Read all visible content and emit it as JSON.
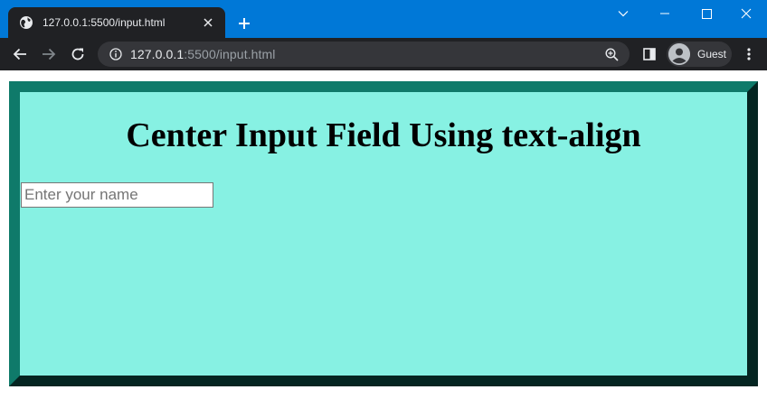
{
  "browser": {
    "tab": {
      "title": "127.0.0.1:5500/input.html"
    },
    "address": {
      "host": "127.0.0.1",
      "rest": ":5500/input.html"
    },
    "profile": {
      "label": "Guest"
    }
  },
  "page": {
    "heading": "Center Input Field Using text-align",
    "input": {
      "placeholder": "Enter your name",
      "value": ""
    }
  },
  "colors": {
    "titlebar": "#0078d7",
    "toolbar": "#202124",
    "box_background": "#87f1e3",
    "box_border": "#0f7a6a"
  },
  "icons": [
    "globe-icon",
    "close-icon",
    "plus-icon",
    "chevron-down-icon",
    "minimize-icon",
    "maximize-icon",
    "back-icon",
    "forward-icon",
    "reload-icon",
    "info-icon",
    "zoom-icon",
    "side-panel-icon",
    "avatar-icon",
    "more-icon"
  ]
}
